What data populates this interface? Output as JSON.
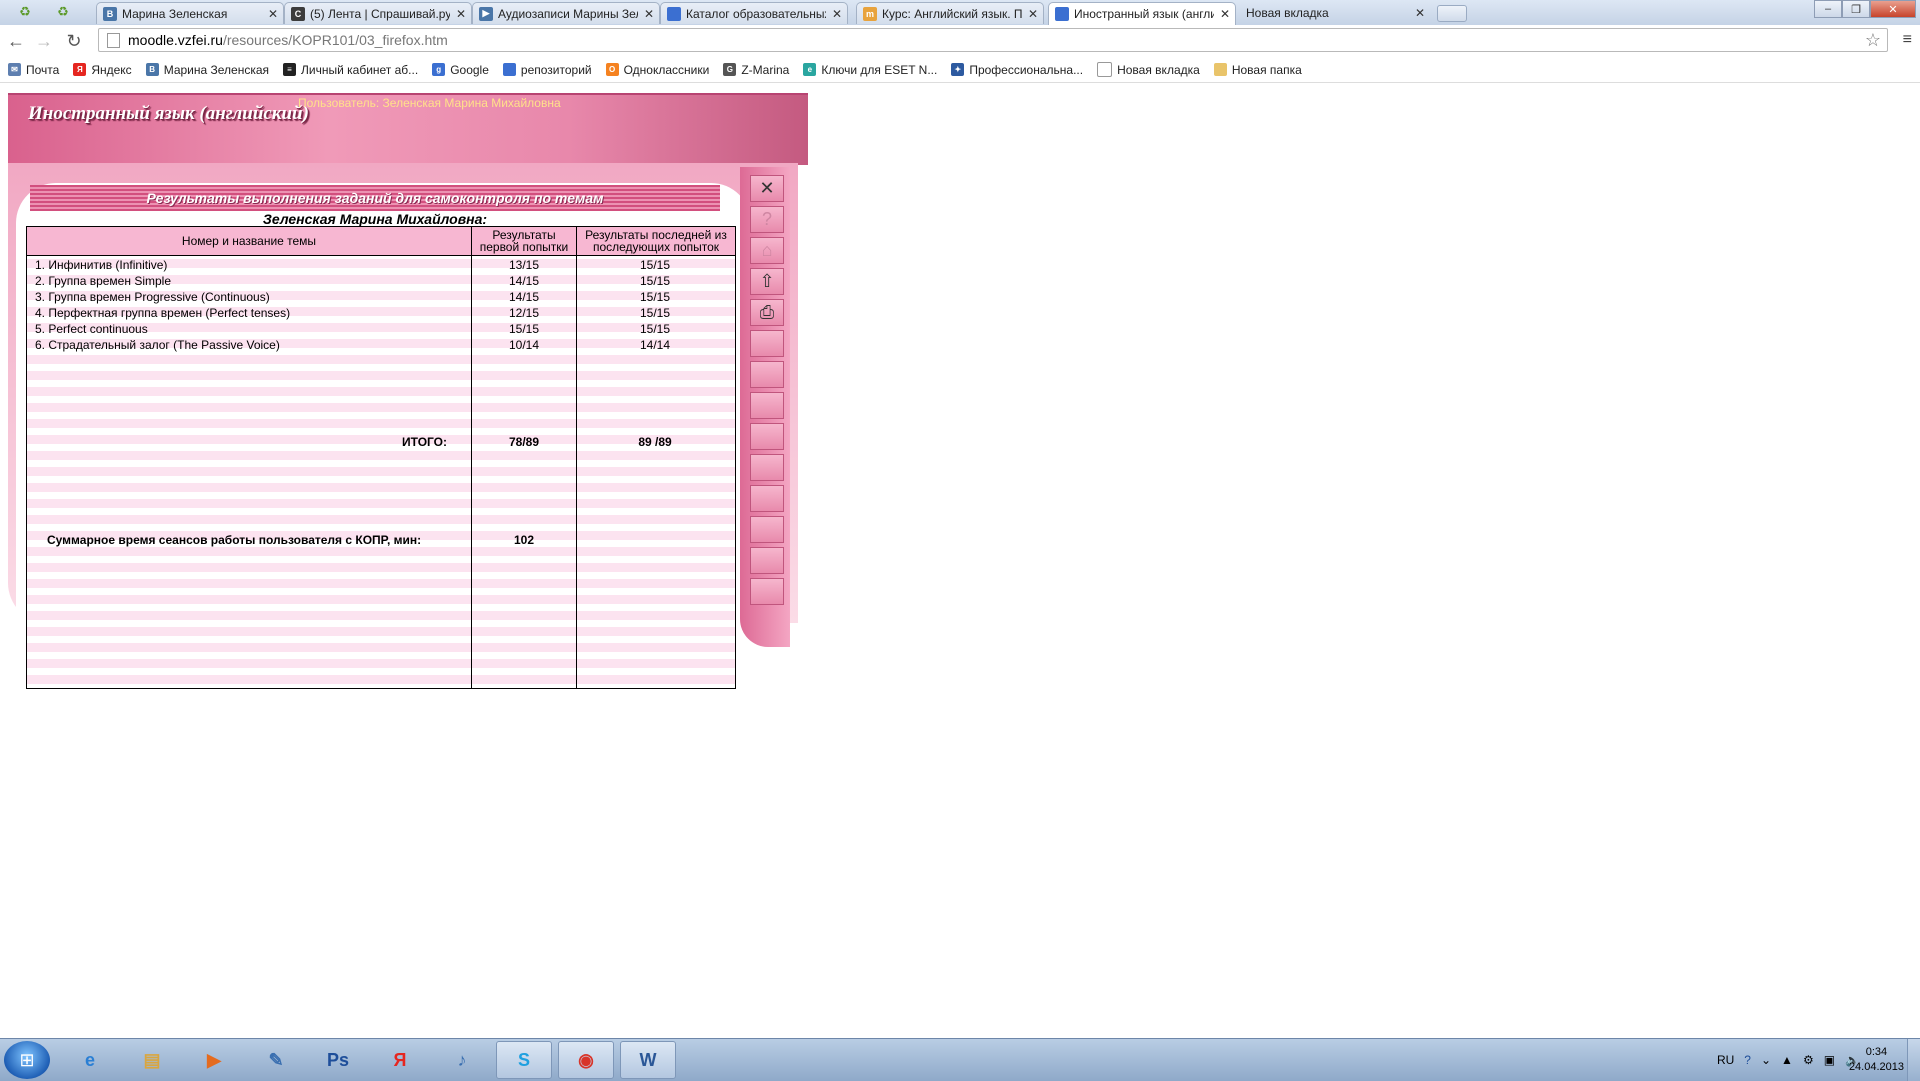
{
  "browser": {
    "tabs": [
      {
        "label": "Марина Зеленская",
        "icon": "vk-icon",
        "color": "#4a76a8",
        "glyph": "В"
      },
      {
        "label": "(5) Лента | Спрашивай.ру",
        "icon": "sprashivai-icon",
        "color": "#3c3c3c",
        "glyph": "С"
      },
      {
        "label": "Аудиозаписи Марины Зеленской",
        "icon": "audio-icon",
        "color": "#4a76a8",
        "glyph": "▶"
      },
      {
        "label": "Каталог образовательных ресурсов",
        "icon": "page-icon",
        "color": "#3b6fd1",
        "glyph": ""
      },
      {
        "label": "Курс: Английский язык. Продолжение",
        "icon": "moodle-icon",
        "color": "#e8a33d",
        "glyph": "m"
      },
      {
        "label": "Иностранный язык (английский)",
        "icon": "page-icon",
        "color": "#3b6fd1",
        "glyph": ""
      },
      {
        "label": "Новая вкладка",
        "icon": "",
        "color": "",
        "glyph": ""
      }
    ],
    "url_host": "moodle.vzfei.ru",
    "url_path": "/resources/KOPR101/03_firefox.htm",
    "bookmarks": [
      {
        "label": "Почта",
        "icon": "mail-icon",
        "color": "#5e7fb0",
        "glyph": "✉"
      },
      {
        "label": "Яндекс",
        "icon": "yandex-icon",
        "color": "#e52620",
        "glyph": "Я"
      },
      {
        "label": "Марина Зеленская",
        "icon": "vk-icon",
        "color": "#4a76a8",
        "glyph": "В"
      },
      {
        "label": "Личный кабинет аб...",
        "icon": "beeline-icon",
        "color": "#222",
        "glyph": "≡"
      },
      {
        "label": "Google",
        "icon": "google-icon",
        "color": "#3b6fd1",
        "glyph": "g"
      },
      {
        "label": "репозиторий",
        "icon": "page-icon",
        "color": "#3b6fd1",
        "glyph": ""
      },
      {
        "label": "Одноклассники",
        "icon": "ok-icon",
        "color": "#f58220",
        "glyph": "О"
      },
      {
        "label": "Z-Marina",
        "icon": "g-icon",
        "color": "#555",
        "glyph": "G"
      },
      {
        "label": "Ключи для ESET N...",
        "icon": "eset-icon",
        "color": "#2aa6a0",
        "glyph": "e"
      },
      {
        "label": "Профессиональна...",
        "icon": "logo-icon",
        "color": "#2d5aa0",
        "glyph": "✦"
      },
      {
        "label": "Новая вкладка",
        "icon": "blank-page-icon",
        "color": "#ffffff",
        "glyph": ""
      },
      {
        "label": "Новая папка",
        "icon": "folder-icon",
        "color": "#e9c46a",
        "glyph": ""
      }
    ]
  },
  "app": {
    "title": "Иностранный язык (английский)",
    "user_line": "Пользователь: Зеленская Марина Михайловна",
    "results_title": "Результаты выполнения заданий для самоконтроля по темам",
    "student_name": "Зеленская Марина Михайловна:",
    "columns": {
      "topic": "Номер и название темы",
      "first": "Результаты первой попытки",
      "last": "Результаты последней из последующих попыток"
    },
    "rows": [
      {
        "topic": "1. Инфинитив (Infinitive)",
        "first": "13/15",
        "last": "15/15"
      },
      {
        "topic": "2. Группа времен Simple",
        "first": "14/15",
        "last": "15/15"
      },
      {
        "topic": "3. Группа времен Progressive (Continuous)",
        "first": "14/15",
        "last": "15/15"
      },
      {
        "topic": "4. Перфектная группа времен (Perfect tenses)",
        "first": "12/15",
        "last": "15/15"
      },
      {
        "topic": "5. Perfect continuous",
        "first": "15/15",
        "last": "15/15"
      },
      {
        "topic": "6. Страдательный залог (The Passive Voice)",
        "first": "10/14",
        "last": "14/14"
      }
    ],
    "total_label": "ИТОГО:",
    "total_first": "78/89",
    "total_last": "89 /89",
    "time_label": "Суммарное время сеансов работы пользователя с КОПР, мин:",
    "time_value": "102",
    "side_buttons": [
      "close-icon",
      "help-icon",
      "home-icon",
      "up-arrow-icon",
      "print-icon",
      "",
      "",
      "",
      "",
      "",
      "",
      "",
      "",
      ""
    ]
  },
  "taskbar": {
    "apps": [
      {
        "name": "ie-icon",
        "glyph": "e",
        "color": "#2a7fd4",
        "open": false
      },
      {
        "name": "explorer-icon",
        "glyph": "▤",
        "color": "#d9a640",
        "open": false
      },
      {
        "name": "media-player-icon",
        "glyph": "▶",
        "color": "#e46b1f",
        "open": false
      },
      {
        "name": "tool-icon",
        "glyph": "✎",
        "color": "#3a6fb0",
        "open": false
      },
      {
        "name": "photoshop-icon",
        "glyph": "Ps",
        "color": "#1e4e9a",
        "open": false
      },
      {
        "name": "yandex-browser-icon",
        "glyph": "Я",
        "color": "#e52620",
        "open": false
      },
      {
        "name": "speaker-icon",
        "glyph": "♪",
        "color": "#3a6fb0",
        "open": false
      },
      {
        "name": "skype-icon",
        "glyph": "S",
        "color": "#1fa0e0",
        "open": true
      },
      {
        "name": "chrome-icon",
        "glyph": "◉",
        "color": "#d8352a",
        "open": true
      },
      {
        "name": "word-icon",
        "glyph": "W",
        "color": "#2b5797",
        "open": true
      }
    ],
    "lang": "RU",
    "time": "0:34",
    "date": "24.04.2013"
  }
}
